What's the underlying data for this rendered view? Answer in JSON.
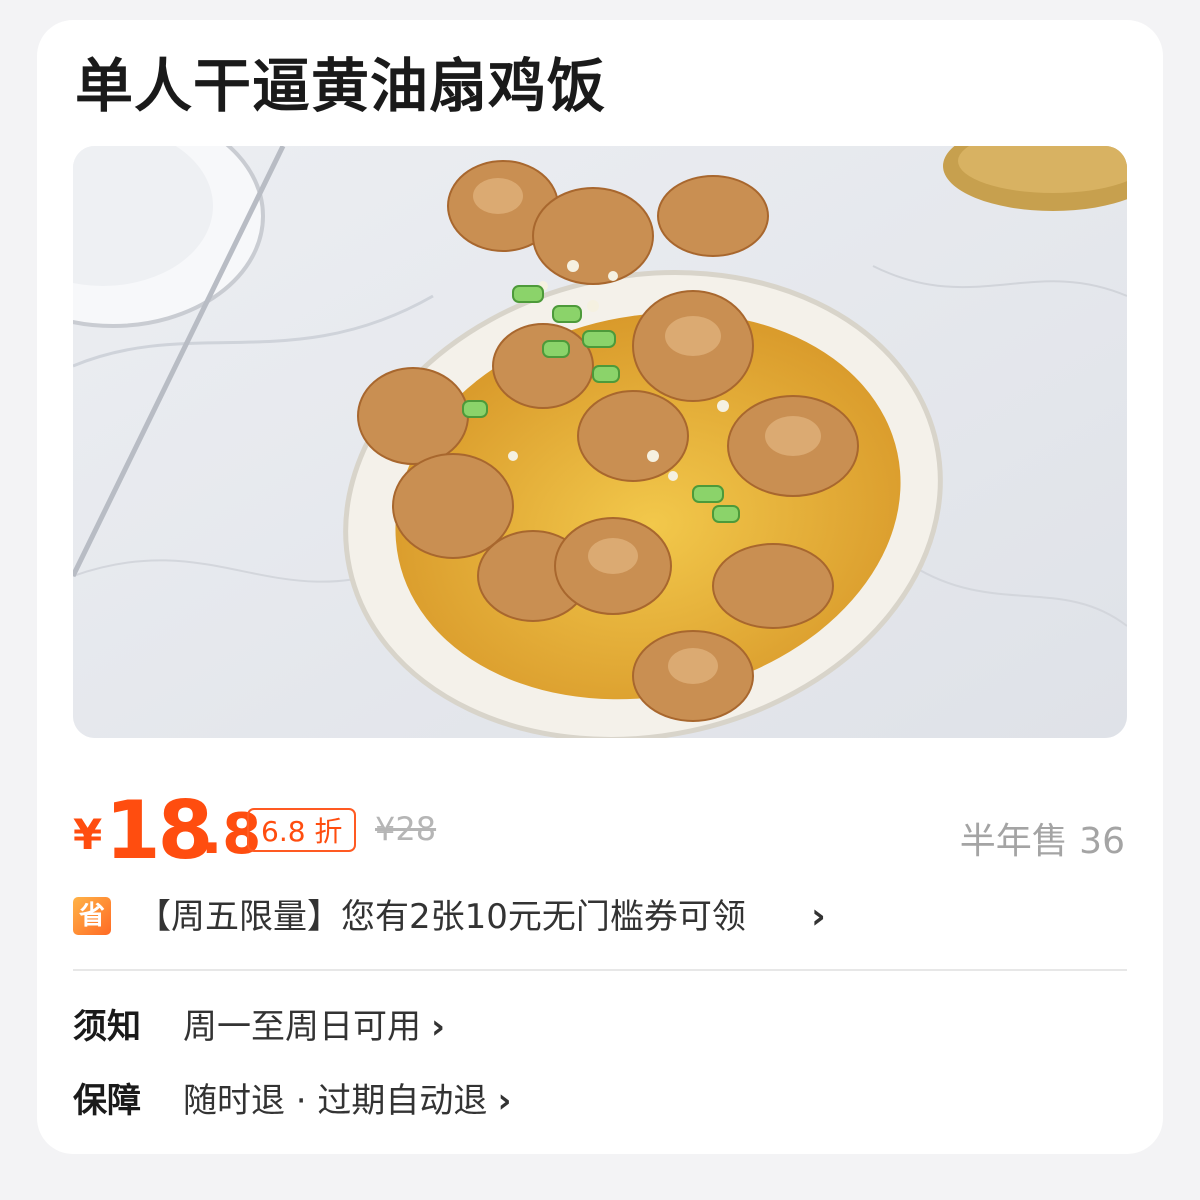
{
  "product": {
    "title": "单人干逼黄油扇鸡饭",
    "photo_alt": "food-photo"
  },
  "price": {
    "currency": "¥",
    "integer": "18",
    "decimal": ".8",
    "discount": "6.8 折",
    "original": "¥28",
    "sales": "半年售 36"
  },
  "coupon": {
    "badge": "省",
    "text": "【周五限量】您有2张10元无门槛券可领",
    "chevron": "›"
  },
  "notice": {
    "label": "须知",
    "value": "周一至周日可用",
    "chevron": "›"
  },
  "guarantee": {
    "label": "保障",
    "value": "随时退 · 过期自动退",
    "chevron": "›"
  },
  "colors": {
    "accent": "#ff4d0f",
    "muted": "#a4a4a4"
  }
}
